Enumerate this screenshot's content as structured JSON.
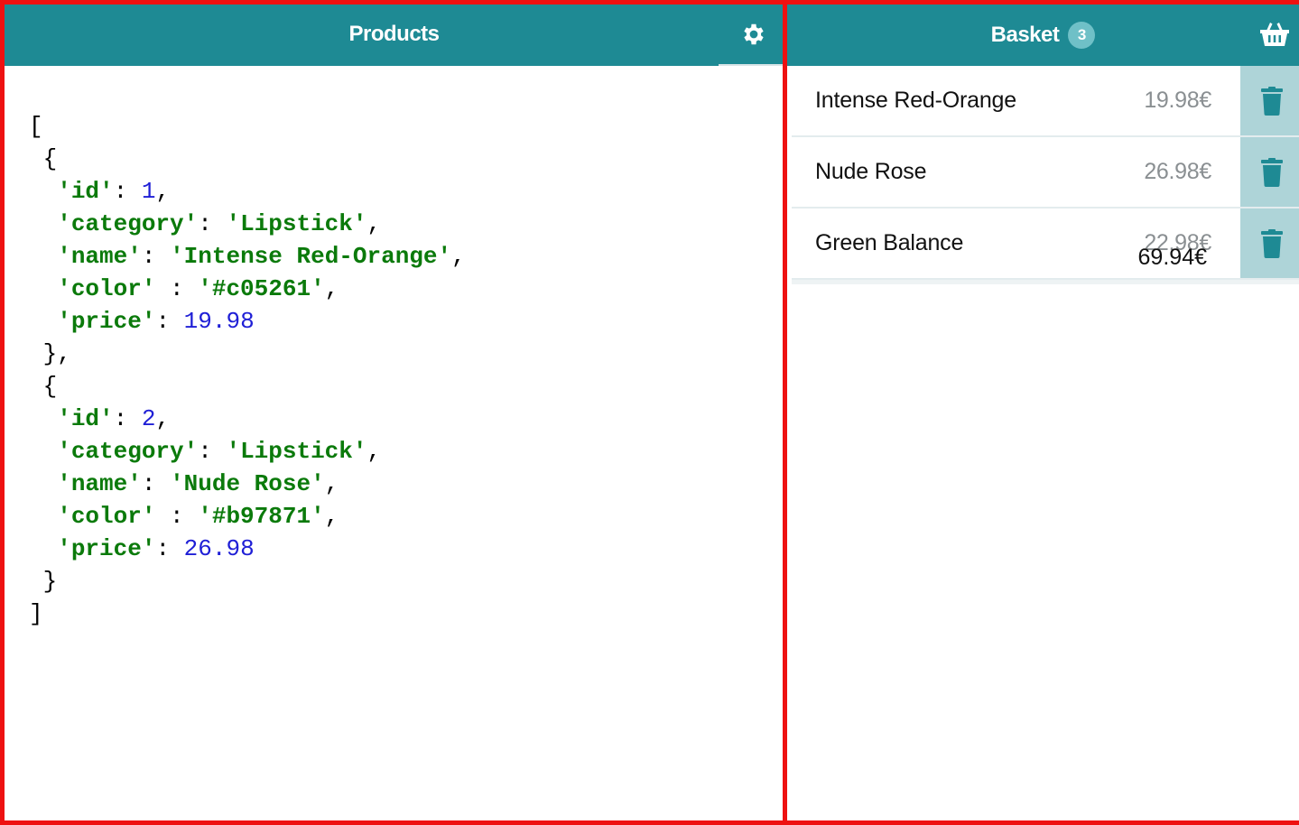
{
  "products_panel": {
    "title": "Products",
    "settings_icon": "gear-icon",
    "code_lines": [
      [
        {
          "t": "p",
          "v": "["
        }
      ],
      [
        {
          "t": "p",
          "v": " {"
        }
      ],
      [
        {
          "t": "p",
          "v": "  "
        },
        {
          "t": "s",
          "v": "'id'"
        },
        {
          "t": "p",
          "v": ": "
        },
        {
          "t": "n",
          "v": "1"
        },
        {
          "t": "p",
          "v": ","
        }
      ],
      [
        {
          "t": "p",
          "v": "  "
        },
        {
          "t": "s",
          "v": "'category'"
        },
        {
          "t": "p",
          "v": ": "
        },
        {
          "t": "s",
          "v": "'Lipstick'"
        },
        {
          "t": "p",
          "v": ","
        }
      ],
      [
        {
          "t": "p",
          "v": "  "
        },
        {
          "t": "s",
          "v": "'name'"
        },
        {
          "t": "p",
          "v": ": "
        },
        {
          "t": "s",
          "v": "'Intense Red-Orange'"
        },
        {
          "t": "p",
          "v": ","
        }
      ],
      [
        {
          "t": "p",
          "v": "  "
        },
        {
          "t": "s",
          "v": "'color'"
        },
        {
          "t": "p",
          "v": " : "
        },
        {
          "t": "s",
          "v": "'#c05261'"
        },
        {
          "t": "p",
          "v": ","
        }
      ],
      [
        {
          "t": "p",
          "v": "  "
        },
        {
          "t": "s",
          "v": "'price'"
        },
        {
          "t": "p",
          "v": ": "
        },
        {
          "t": "n",
          "v": "19.98"
        }
      ],
      [
        {
          "t": "p",
          "v": " },"
        }
      ],
      [
        {
          "t": "p",
          "v": " {"
        }
      ],
      [
        {
          "t": "p",
          "v": "  "
        },
        {
          "t": "s",
          "v": "'id'"
        },
        {
          "t": "p",
          "v": ": "
        },
        {
          "t": "n",
          "v": "2"
        },
        {
          "t": "p",
          "v": ","
        }
      ],
      [
        {
          "t": "p",
          "v": "  "
        },
        {
          "t": "s",
          "v": "'category'"
        },
        {
          "t": "p",
          "v": ": "
        },
        {
          "t": "s",
          "v": "'Lipstick'"
        },
        {
          "t": "p",
          "v": ","
        }
      ],
      [
        {
          "t": "p",
          "v": "  "
        },
        {
          "t": "s",
          "v": "'name'"
        },
        {
          "t": "p",
          "v": ": "
        },
        {
          "t": "s",
          "v": "'Nude Rose'"
        },
        {
          "t": "p",
          "v": ","
        }
      ],
      [
        {
          "t": "p",
          "v": "  "
        },
        {
          "t": "s",
          "v": "'color'"
        },
        {
          "t": "p",
          "v": " : "
        },
        {
          "t": "s",
          "v": "'#b97871'"
        },
        {
          "t": "p",
          "v": ","
        }
      ],
      [
        {
          "t": "p",
          "v": "  "
        },
        {
          "t": "s",
          "v": "'price'"
        },
        {
          "t": "p",
          "v": ": "
        },
        {
          "t": "n",
          "v": "26.98"
        }
      ],
      [
        {
          "t": "p",
          "v": " }"
        }
      ],
      [
        {
          "t": "p",
          "v": "]"
        }
      ]
    ]
  },
  "basket_panel": {
    "title": "Basket",
    "count": "3",
    "basket_icon": "basket-icon",
    "items": [
      {
        "name": "Intense Red-Orange",
        "price": "19.98€",
        "delete_icon": "trash-icon"
      },
      {
        "name": "Nude Rose",
        "price": "26.98€",
        "delete_icon": "trash-icon"
      },
      {
        "name": "Green Balance",
        "price": "22.98€",
        "delete_icon": "trash-icon"
      }
    ],
    "total": "69.94€"
  },
  "colors": {
    "header_bg": "#1e8a94",
    "badge_bg": "#6fc0c7",
    "delete_bg": "#aed4d8",
    "code_string": "#0b7a0b",
    "code_number": "#1f1fd6",
    "panel_border": "#ee1111"
  }
}
